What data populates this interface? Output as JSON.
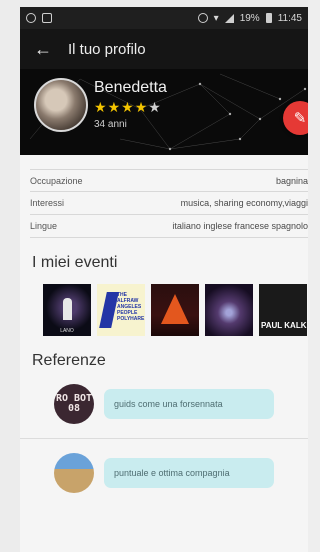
{
  "status_bar": {
    "time": "11:45",
    "battery": "19%"
  },
  "appbar": {
    "title": "Il tuo profilo"
  },
  "profile": {
    "name": "Benedetta",
    "age": "34 anni",
    "rating": 4,
    "rating_max": 5
  },
  "info": [
    {
      "label": "Occupazione",
      "value": "bagnina"
    },
    {
      "label": "Interessi",
      "value": "musica, sharing economy,viaggi"
    },
    {
      "label": "Lingue",
      "value": "italiano inglese francese spagnolo"
    }
  ],
  "events": {
    "title": "I miei eventi",
    "items": [
      {
        "caption": "LANO"
      },
      {
        "caption": "THE ALFRAW ANGELES PEOPLE POLYHARE"
      },
      {
        "caption": ""
      },
      {
        "caption": ""
      },
      {
        "caption": "PAUL KALK"
      }
    ]
  },
  "references": {
    "title": "Referenze",
    "items": [
      {
        "avatar_text": "RO BOT 08",
        "text": "guids come una forsennata"
      },
      {
        "avatar_text": "",
        "text": "puntuale e ottima compagnia"
      }
    ]
  },
  "colors": {
    "edit": "#e53935",
    "star": "#f3c400",
    "bubble": "#c9ecef"
  }
}
